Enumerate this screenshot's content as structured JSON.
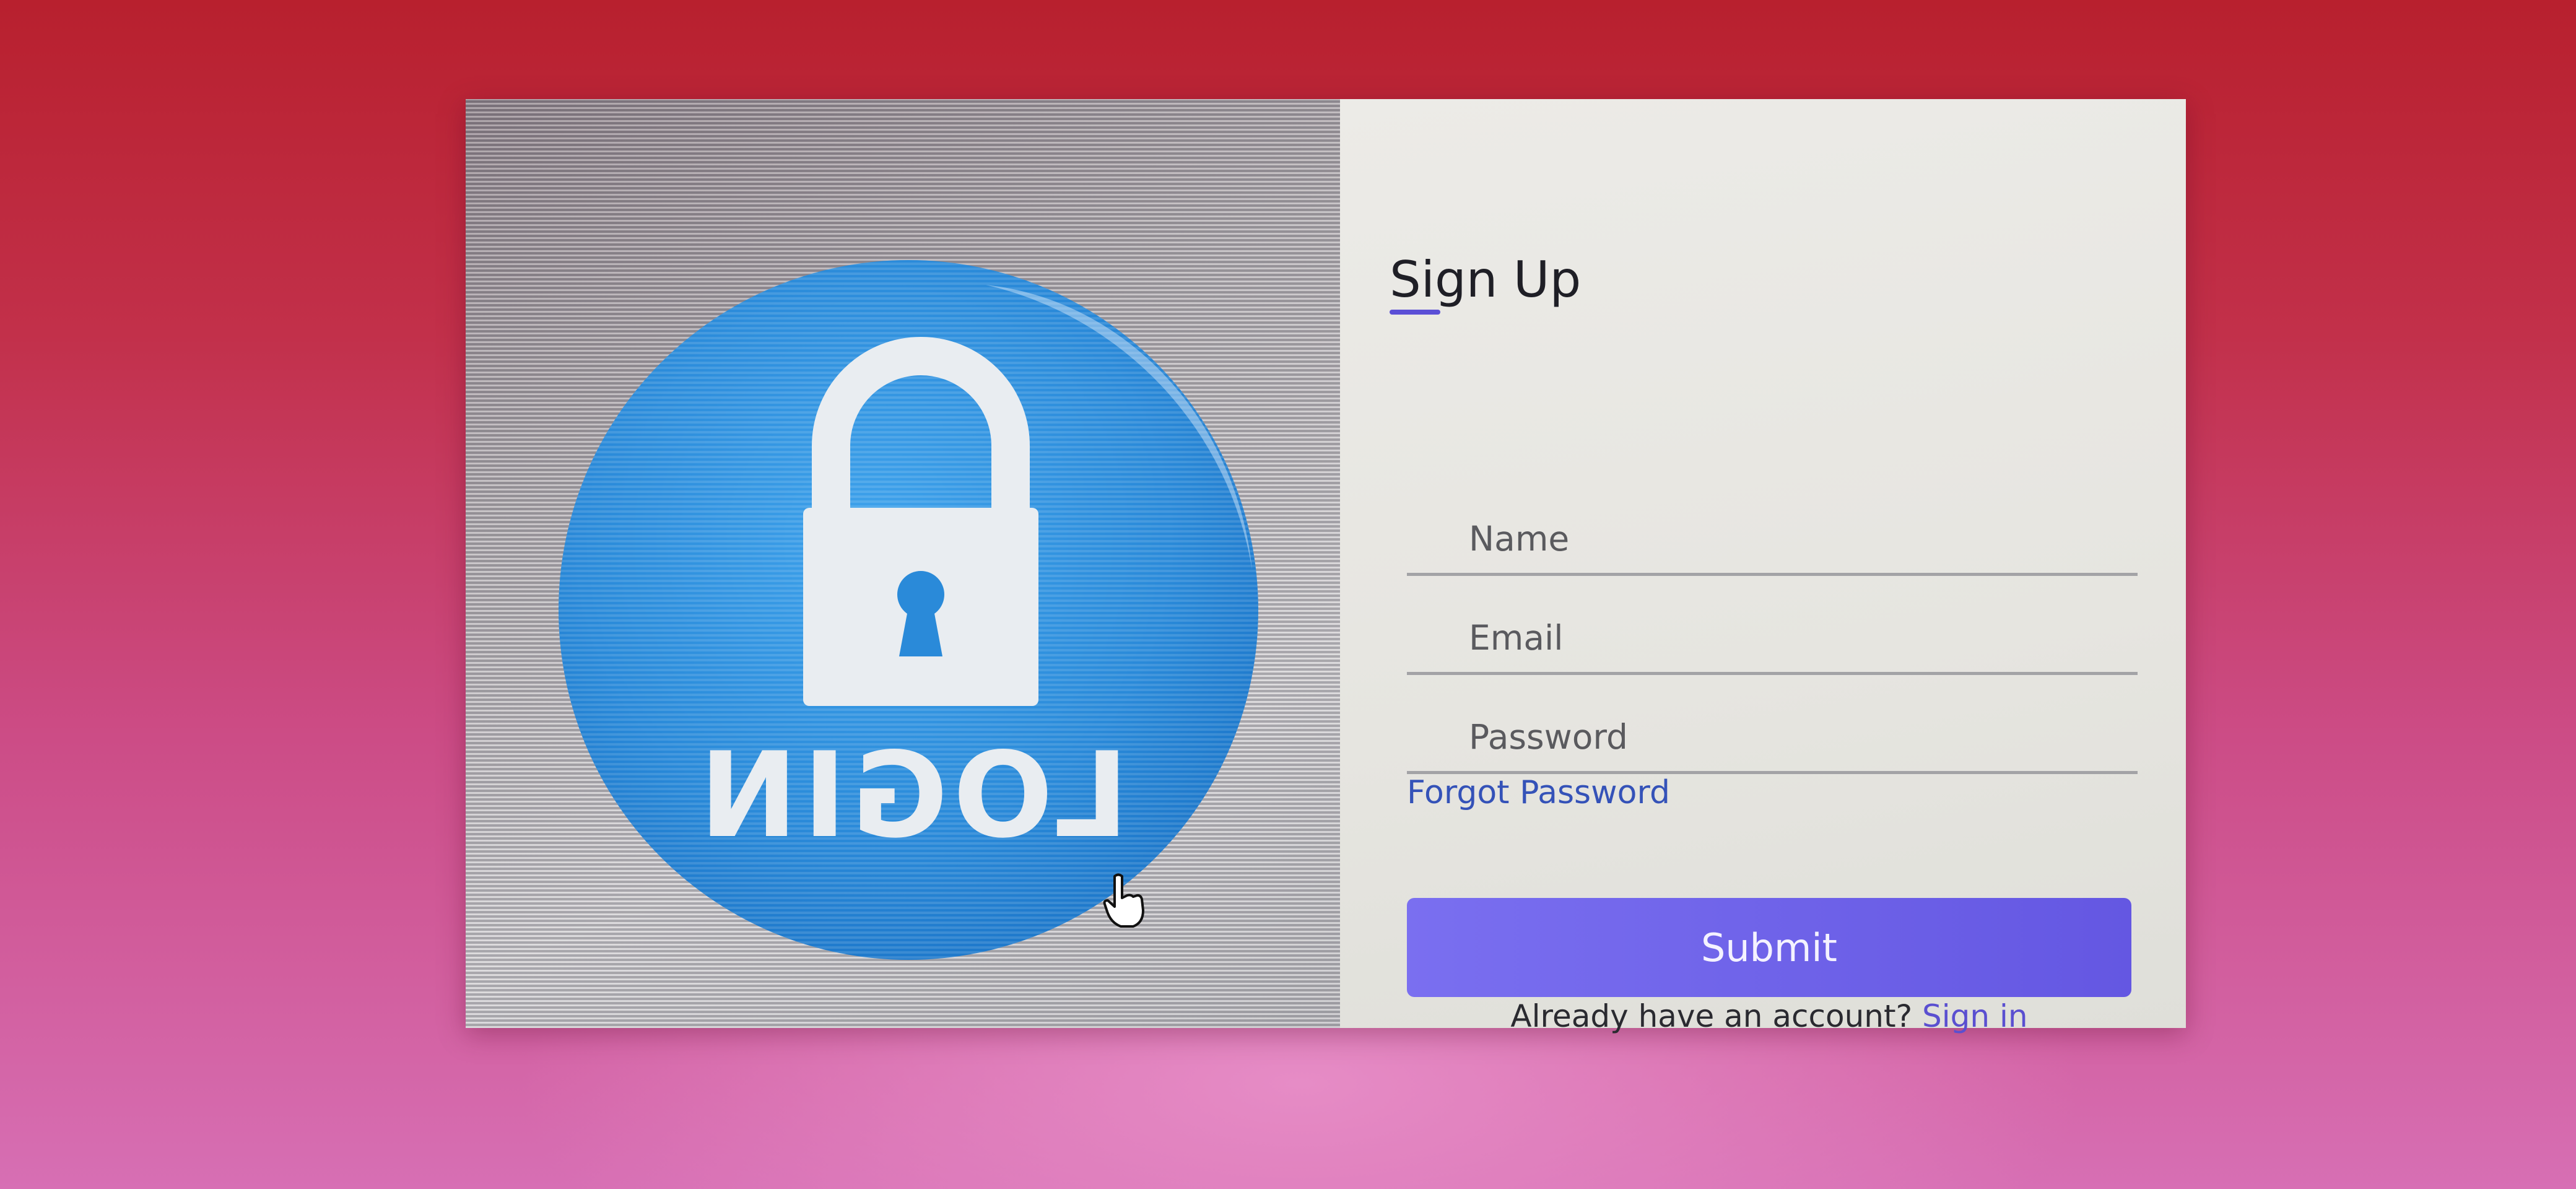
{
  "form": {
    "title": "Sign Up",
    "name_placeholder": "Name",
    "email_placeholder": "Email",
    "password_placeholder": "Password",
    "forgot_label": "Forgot Password",
    "submit_label": "Submit",
    "account_prompt": "Already have an account?",
    "signin_label": "Sign in"
  },
  "hero": {
    "image_text": "LOGIN",
    "icon": "lock-icon"
  },
  "colors": {
    "accent": "#6a5ee6",
    "link": "#3452b8",
    "hero_blue": "#2e8fe0"
  }
}
